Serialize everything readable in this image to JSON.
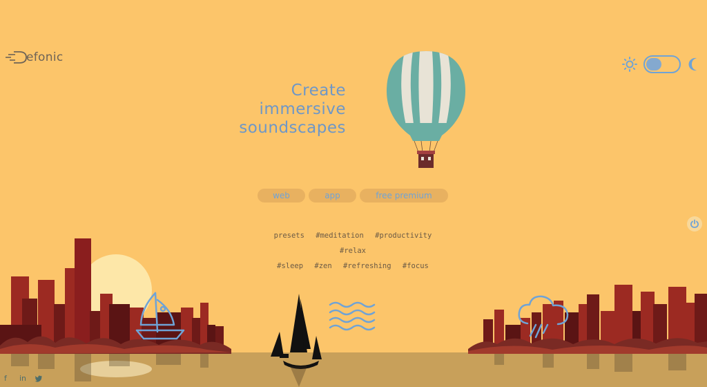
{
  "brand": {
    "name": "efonic",
    "logo_icon": "sound-wave-d-icon"
  },
  "theme": {
    "light_icon": "sun-icon",
    "dark_icon": "moon-icon",
    "mode": "light"
  },
  "headline": {
    "line1": "Create",
    "line2": "immersive",
    "line3": "soundscapes"
  },
  "tabs": [
    {
      "label": "web"
    },
    {
      "label": "app"
    },
    {
      "label": "free premium"
    }
  ],
  "tags": [
    "presets",
    "#meditation",
    "#productivity",
    "#relax",
    "#sleep",
    "#zen",
    "#refreshing",
    "#focus"
  ],
  "sound_icons": {
    "sailboat": "sailboat-icon",
    "waves": "waves-icon",
    "rain": "rain-cloud-icon"
  },
  "power_icon": "power-icon",
  "socials": [
    {
      "icon": "facebook-icon",
      "label": "f"
    },
    {
      "icon": "linkedin-icon",
      "label": "in"
    },
    {
      "icon": "twitter-icon",
      "label": "t"
    }
  ],
  "colors": {
    "background": "#fcc56a",
    "accent": "#6fa3d6",
    "city_dark": "#5a1414",
    "city_red": "#9c2a22",
    "water": "#c8a05a"
  }
}
